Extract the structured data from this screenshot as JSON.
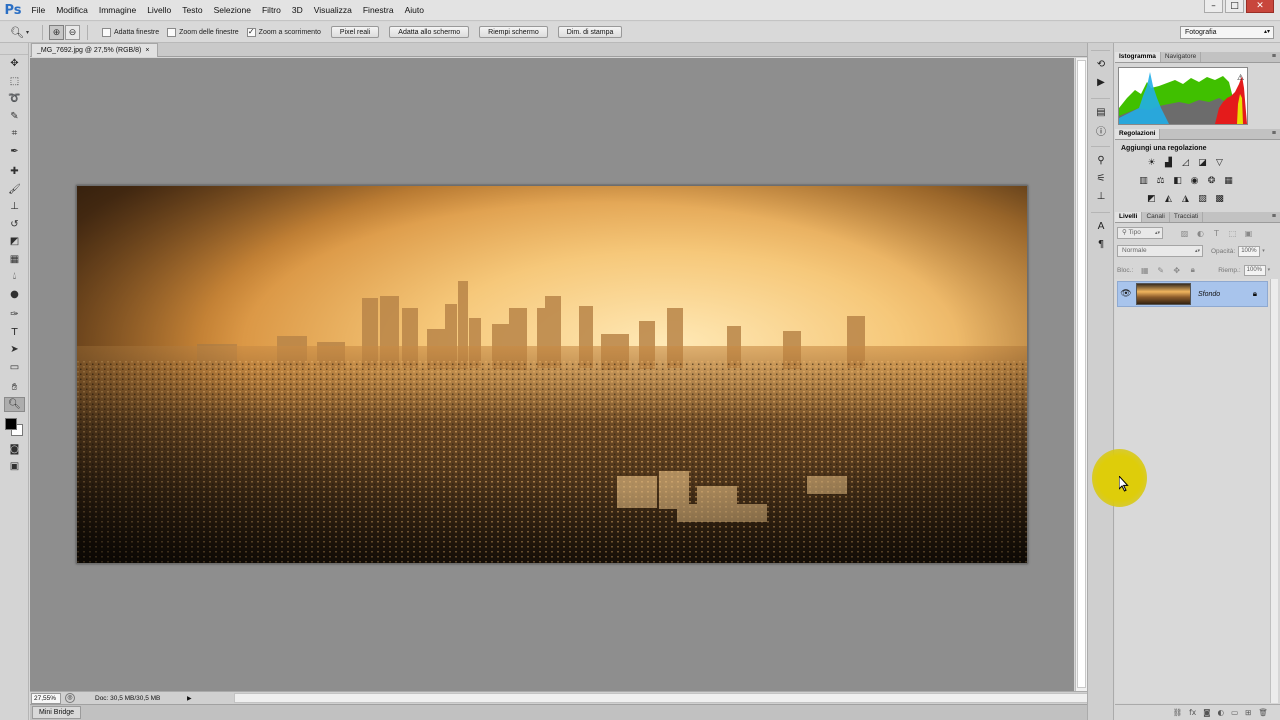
{
  "app": {
    "logo": "Ps"
  },
  "menubar": {
    "items": [
      "File",
      "Modifica",
      "Immagine",
      "Livello",
      "Testo",
      "Selezione",
      "Filtro",
      "3D",
      "Visualizza",
      "Finestra",
      "Aiuto"
    ]
  },
  "window_controls": {
    "minimize": "–",
    "maximize": "□",
    "close": "✕"
  },
  "options_bar": {
    "checkbox_fit_windows": "Adatta finestre",
    "checkbox_zoom_all": "Zoom delle finestre",
    "checkbox_scrubby_zoom": "Zoom a scorrimento",
    "btn_actual_pixels": "Pixel reali",
    "btn_fit_screen": "Adatta allo schermo",
    "btn_fill_screen": "Riempi schermo",
    "btn_print_size": "Dim. di stampa",
    "workspace": "Fotografia"
  },
  "document": {
    "tab_title": "_MG_7692.jpg @ 27,5% (RGB/8)",
    "close_glyph": "×"
  },
  "status_bar": {
    "zoom": "27,55%",
    "doc_info": "Doc: 30,5 MB/30,5 MB"
  },
  "mini_bridge": {
    "label": "Mini Bridge"
  },
  "panels": {
    "histogram_tabs": [
      "Istogramma",
      "Navigatore"
    ],
    "adjustments_tab": "Regolazioni",
    "adjustments_title": "Aggiungi una regolazione",
    "layers_tabs": [
      "Livelli",
      "Canali",
      "Tracciati"
    ],
    "filter_type": "Tipo",
    "blend_mode": "Normale",
    "opacity_label": "Opacità:",
    "opacity_value": "100%",
    "lock_label": "Bloc.:",
    "fill_label": "Riemp.:",
    "fill_value": "100%",
    "layer_name": "Sfondo"
  },
  "colors": {
    "accent_selection": "#a8c4ec",
    "fg": "#000000",
    "bg": "#ffffff"
  }
}
